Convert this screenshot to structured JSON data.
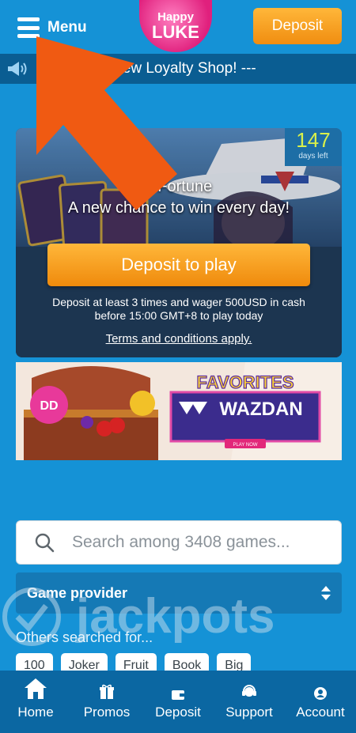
{
  "header": {
    "menu_label": "Menu",
    "logo_text_top": "Happy",
    "logo_text_bottom": "LUKE",
    "deposit_label": "Deposit"
  },
  "ticker": {
    "text": "r... with our new Loyalty Shop! ---"
  },
  "promo": {
    "days_count": "147",
    "days_label": "days left",
    "heading": "s Fortune",
    "subheading": "A new chance to win every day!",
    "cta_label": "Deposit to play",
    "description": "Deposit at least 3 times and wager 500USD in cash before 15:00 GMT+8 to play today",
    "terms_label": "Terms and conditions apply."
  },
  "banner": {
    "title": "FAVORITES",
    "brand": "WAZDAN",
    "button": "PLAY NOW"
  },
  "search": {
    "placeholder": "Search among 3408 games..."
  },
  "filter": {
    "provider_label": "Game provider"
  },
  "watermark": {
    "text": "jackpots"
  },
  "others": {
    "label": "Others searched for...",
    "chips": [
      "100",
      "Joker",
      "Fruit",
      "Book",
      "Big"
    ]
  },
  "bottom_nav": {
    "items": [
      {
        "label": "Home",
        "icon": "home-icon"
      },
      {
        "label": "Promos",
        "icon": "gift-icon"
      },
      {
        "label": "Deposit",
        "icon": "wallet-icon"
      },
      {
        "label": "Support",
        "icon": "headset-icon"
      },
      {
        "label": "Account",
        "icon": "user-icon"
      }
    ]
  },
  "colors": {
    "background": "#1592d6",
    "accent_orange": "#f59a1d",
    "ticker_bg": "#0a5d92",
    "nav_bg": "#0b67a2",
    "annotation_arrow": "#f05a12"
  }
}
